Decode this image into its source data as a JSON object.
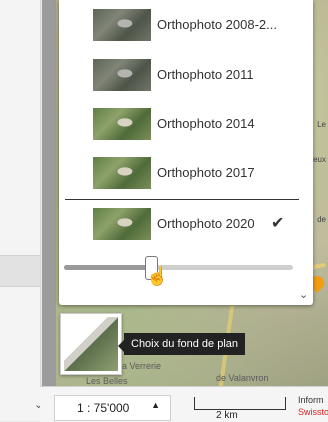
{
  "layers": [
    {
      "label": "Orthophoto 2008-2...",
      "selected": false,
      "vintage": "old"
    },
    {
      "label": "Orthophoto 2011",
      "selected": false,
      "vintage": "old"
    },
    {
      "label": "Orthophoto 2014",
      "selected": false,
      "vintage": "new"
    },
    {
      "label": "Orthophoto 2017",
      "selected": false,
      "vintage": "new"
    },
    {
      "label": "Orthophoto 2020",
      "selected": true,
      "vintage": "new"
    }
  ],
  "check_icon": "✔",
  "scroll_down_icon": "⌄",
  "opacity_slider": {
    "value": 0.38
  },
  "tooltip": {
    "text": "Choix du fond de plan"
  },
  "map_places": {
    "verrerie": "a Verrerie",
    "belles": "Les Belles",
    "valanvron": "de Valanvron",
    "right1": "Le",
    "right2": "eux",
    "right3": "de"
  },
  "scale": {
    "value": "1 : 75'000",
    "caret": "▲",
    "bar_label": "2 km"
  },
  "info": {
    "line1": "Inform",
    "line2": "Swissto"
  },
  "colors": {
    "accent": "#f39c12",
    "tooltip_bg": "#222222",
    "info_red": "#d22222"
  }
}
